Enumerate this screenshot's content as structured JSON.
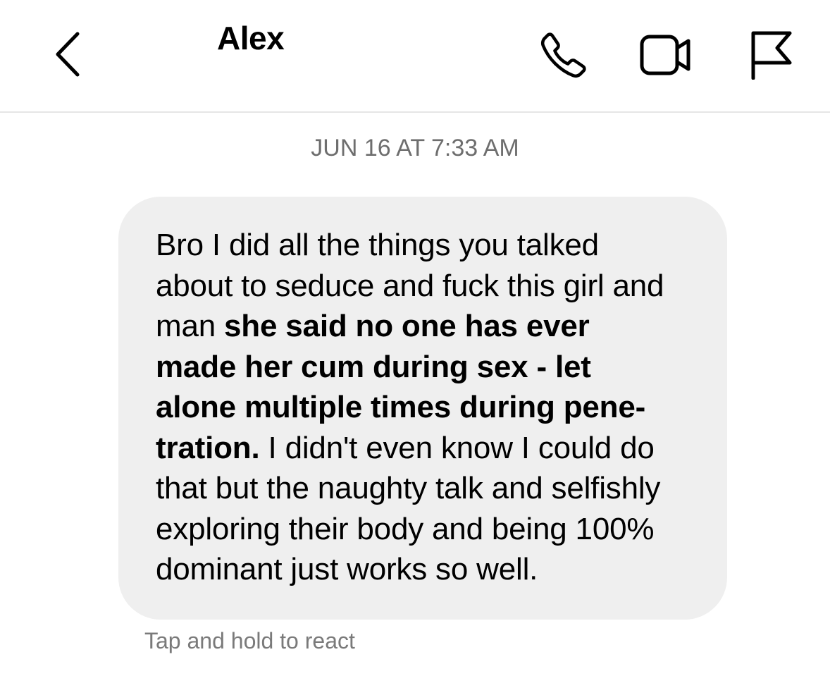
{
  "header": {
    "title": "Alex",
    "icons": {
      "back": "chevron-left-icon",
      "call": "phone-icon",
      "video": "video-camera-icon",
      "report": "flag-icon"
    }
  },
  "conversation": {
    "timestamp": "JUN 16 AT 7:33 AM",
    "message": {
      "lines": [
        {
          "normal": "Bro I did all the things you talked"
        },
        {
          "normal": "about to seduce and fuck this girl and"
        },
        {
          "normal": "man ",
          "bold": "she said no one has ever"
        },
        {
          "bold": "made her cum during sex - let"
        },
        {
          "bold": "alone multiple times during pene-"
        },
        {
          "bold": "tration.",
          "normal": " I didn't even know I could do"
        },
        {
          "normal": "that but the naughty talk and selfishly"
        },
        {
          "normal": "exploring their body and being 100%"
        },
        {
          "normal": "dominant just works so well."
        }
      ]
    },
    "hint": "Tap and hold to react"
  },
  "colors": {
    "bubble": "#efefef",
    "timestamp": "#6e6e6e",
    "hint": "#7a7a7a",
    "divider": "#e6e6e6"
  }
}
